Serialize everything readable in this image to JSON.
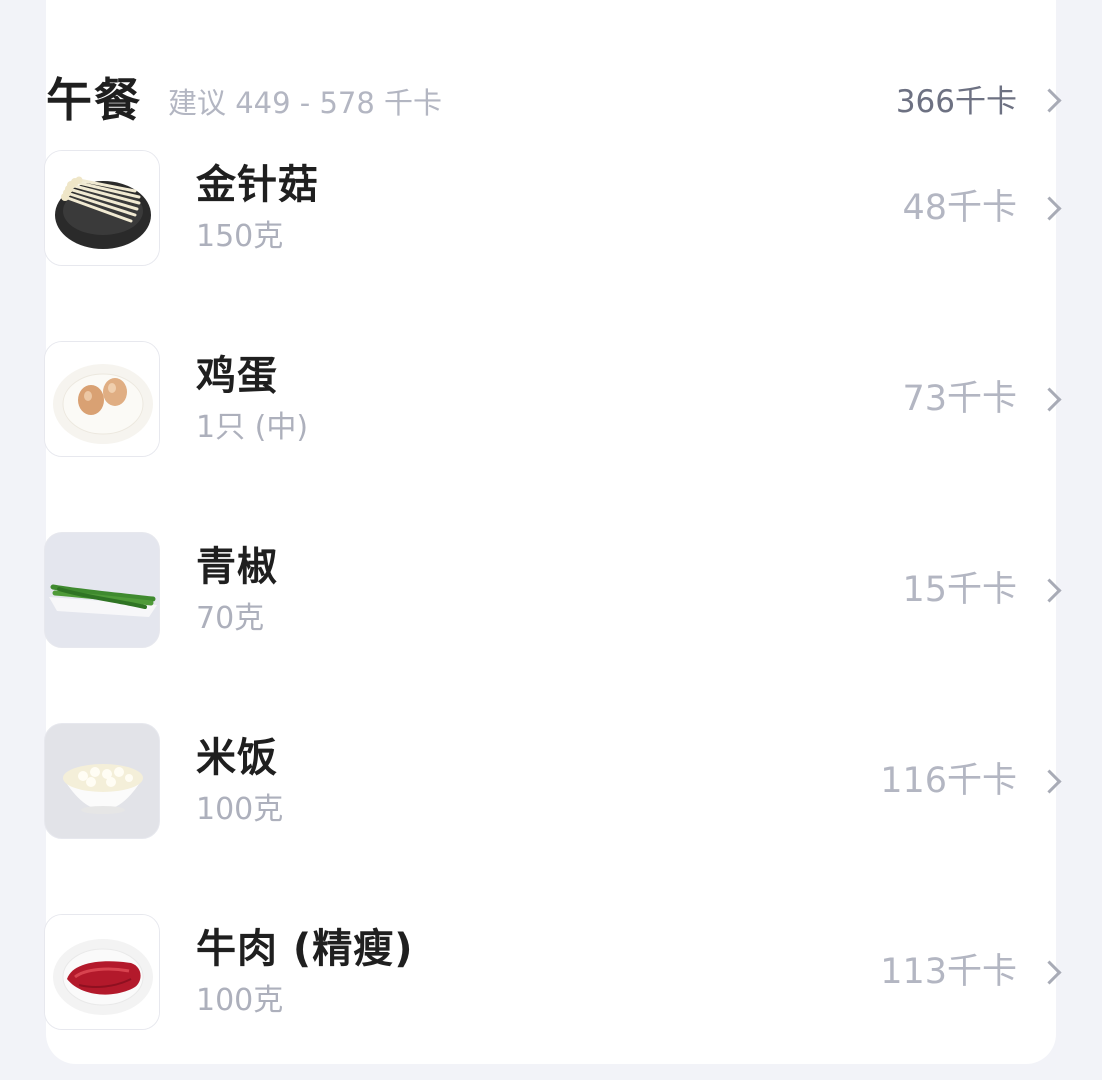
{
  "meal": {
    "title": "午餐",
    "suggestion": "建议 449 - 578 千卡",
    "total": "366千卡",
    "items": [
      {
        "name": "金针菇",
        "amount": "150克",
        "kcal": "48千卡",
        "icon": "enoki-mushroom-icon"
      },
      {
        "name": "鸡蛋",
        "amount": "1只 (中)",
        "kcal": "73千卡",
        "icon": "egg-icon"
      },
      {
        "name": "青椒",
        "amount": "70克",
        "kcal": "15千卡",
        "icon": "green-pepper-icon"
      },
      {
        "name": "米饭",
        "amount": "100克",
        "kcal": "116千卡",
        "icon": "rice-bowl-icon"
      },
      {
        "name": "牛肉 (精瘦)",
        "amount": "100克",
        "kcal": "113千卡",
        "icon": "beef-icon"
      }
    ]
  },
  "colors": {
    "background": "#f2f3f8",
    "card": "#ffffff",
    "title": "#1f1f1f",
    "muted": "#b3b6c2",
    "total": "#6d7182"
  }
}
